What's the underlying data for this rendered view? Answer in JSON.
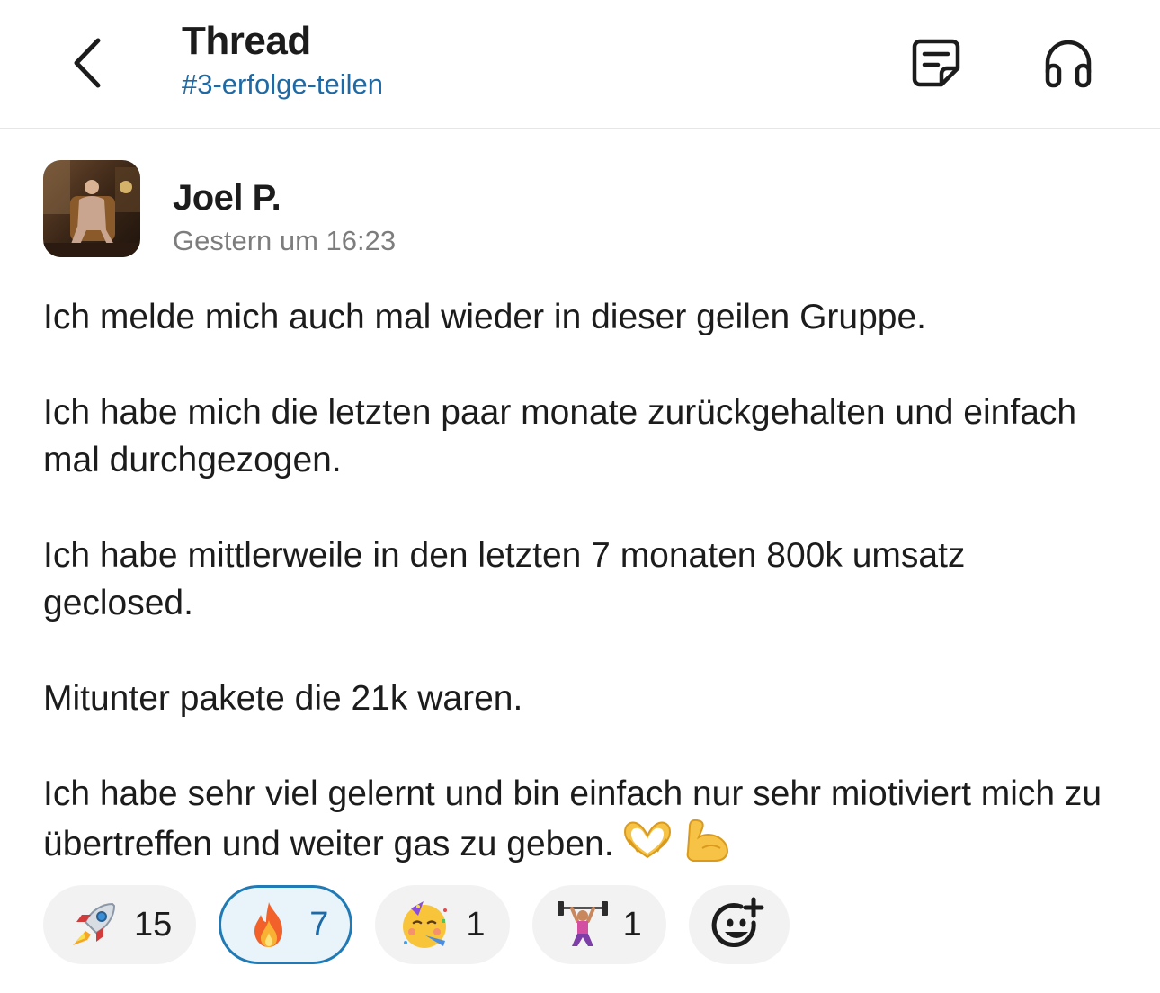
{
  "header": {
    "title": "Thread",
    "channel": "#3-erfolge-teilen",
    "back_icon": "chevron-left-icon",
    "canvas_icon": "canvas-note-icon",
    "huddle_icon": "headphones-icon"
  },
  "post": {
    "author": "Joel P.",
    "timestamp": "Gestern um 16:23",
    "paragraphs": [
      "Ich melde mich auch mal wieder in dieser geilen Gruppe.",
      "Ich habe mich die letzten paar monate zurückgehalten und einfach mal durchgezogen.",
      "Ich habe mittlerweile in den letzten 7 monaten 800k umsatz geclosed.",
      "Mitunter pakete die 21k waren.",
      "Ich habe sehr viel gelernt und bin einfach nur sehr miotiviert mich zu übertreffen und weiter gas zu geben."
    ],
    "trailing_emojis": [
      "heart-hands-emoji",
      "flexed-biceps-emoji"
    ]
  },
  "reactions": [
    {
      "emoji": "rocket-emoji",
      "count": "15",
      "active": false
    },
    {
      "emoji": "fire-emoji",
      "count": "7",
      "active": true
    },
    {
      "emoji": "partying-face-emoji",
      "count": "1",
      "active": false
    },
    {
      "emoji": "weightlifter-emoji",
      "count": "1",
      "active": false
    }
  ],
  "add_reaction_icon": "add-reaction-icon",
  "colors": {
    "link": "#1f6aa5",
    "text": "#1d1c1d",
    "muted": "#7d7d7d",
    "reaction_bg": "#f2f2f2",
    "active_border": "#1f7ab5",
    "active_bg": "#e8f3fa"
  }
}
